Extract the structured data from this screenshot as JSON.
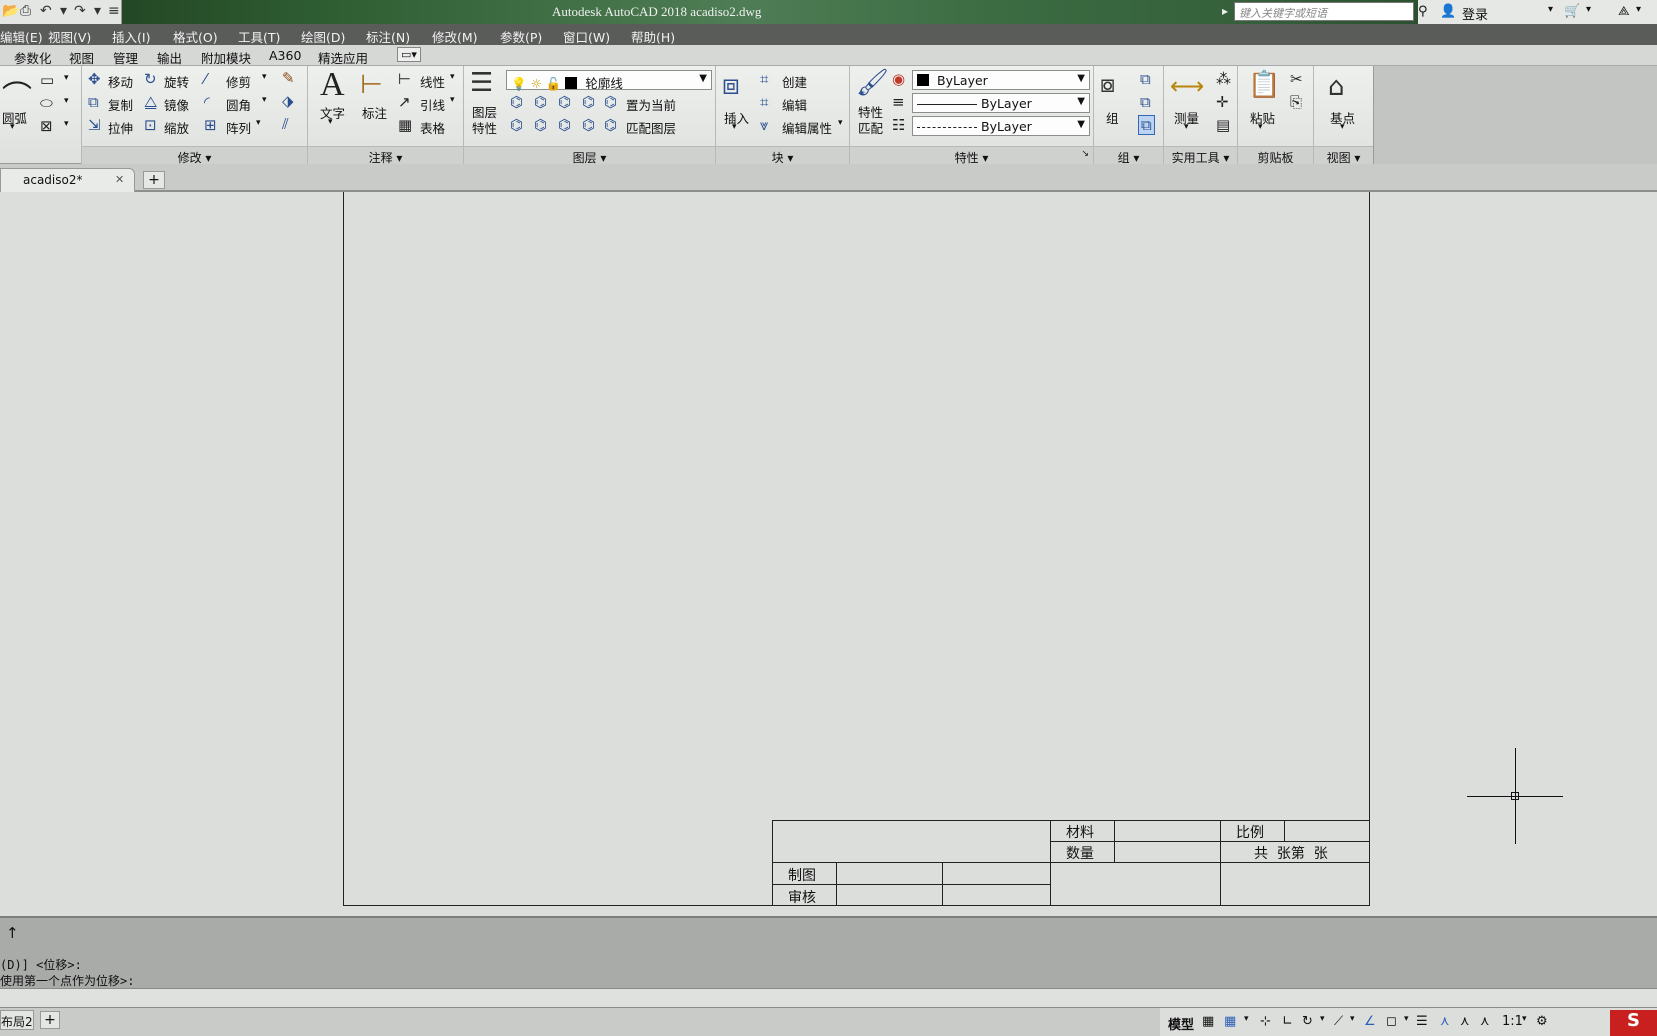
{
  "titlebar": {
    "title": "Autodesk AutoCAD 2018    acadiso2.dwg",
    "search_placeholder": "键入关键字或短语",
    "login_label": "登录",
    "icons": [
      "open-icon",
      "print-icon",
      "undo-icon",
      "redo-icon",
      "binoculars-icon",
      "user-icon",
      "cart-icon",
      "triangle-network-icon"
    ]
  },
  "menubar": {
    "items": [
      "编辑(E)",
      "视图(V)",
      "插入(I)",
      "格式(O)",
      "工具(T)",
      "绘图(D)",
      "标注(N)",
      "修改(M)",
      "参数(P)",
      "窗口(W)",
      "帮助(H)"
    ]
  },
  "ribbon_tabs": [
    "参数化",
    "视图",
    "管理",
    "输出",
    "附加模块",
    "A360",
    "精选应用"
  ],
  "ribbon": {
    "draw": {
      "arc_label": "圆弧"
    },
    "modify": {
      "title": "修改",
      "items": [
        "移动",
        "旋转",
        "修剪",
        "复制",
        "镜像",
        "圆角",
        "拉伸",
        "缩放",
        "阵列"
      ]
    },
    "annotation": {
      "title": "注释",
      "text_label": "文字",
      "dim_label": "标注",
      "items": [
        "线性",
        "引线",
        "表格"
      ]
    },
    "layers": {
      "title": "图层",
      "props_label_1": "图层",
      "props_label_2": "特性",
      "current_layer": "轮廓线",
      "set_current": "置为当前",
      "match_layer": "匹配图层"
    },
    "block": {
      "title": "块",
      "insert_label": "插入",
      "items": [
        "创建",
        "编辑",
        "编辑属性"
      ]
    },
    "properties": {
      "title": "特性",
      "match_label_1": "特性",
      "match_label_2": "匹配",
      "color": "ByLayer",
      "lineweight": "ByLayer",
      "linetype": "ByLayer"
    },
    "group": {
      "title": "组",
      "group_label": "组"
    },
    "utilities": {
      "title": "实用工具",
      "measure_label": "测量"
    },
    "clipboard": {
      "title": "剪贴板",
      "paste_label": "粘贴"
    },
    "view": {
      "title": "视图",
      "base_label": "基点"
    }
  },
  "doc_tabs": {
    "active": "acadiso2*",
    "new_tab": "+"
  },
  "title_block": {
    "material": "材料",
    "scale": "比例",
    "quantity": "数量",
    "sheet_info": "共  张第  张",
    "drawn_by": "制图",
    "checked_by": "审核"
  },
  "command": {
    "history_1": "(D)] <位移>:",
    "history_2": "使用第一个点作为位移>:",
    "input_placeholder": ""
  },
  "statusbar": {
    "layout_tab": "布局2",
    "model_label": "模型",
    "scale_label": "1:1",
    "ime_label": "S"
  },
  "colors": {
    "canvas_bg": "#dcdedc",
    "menubar_bg": "#5a5c5a",
    "ime_red": "#c8201e"
  }
}
